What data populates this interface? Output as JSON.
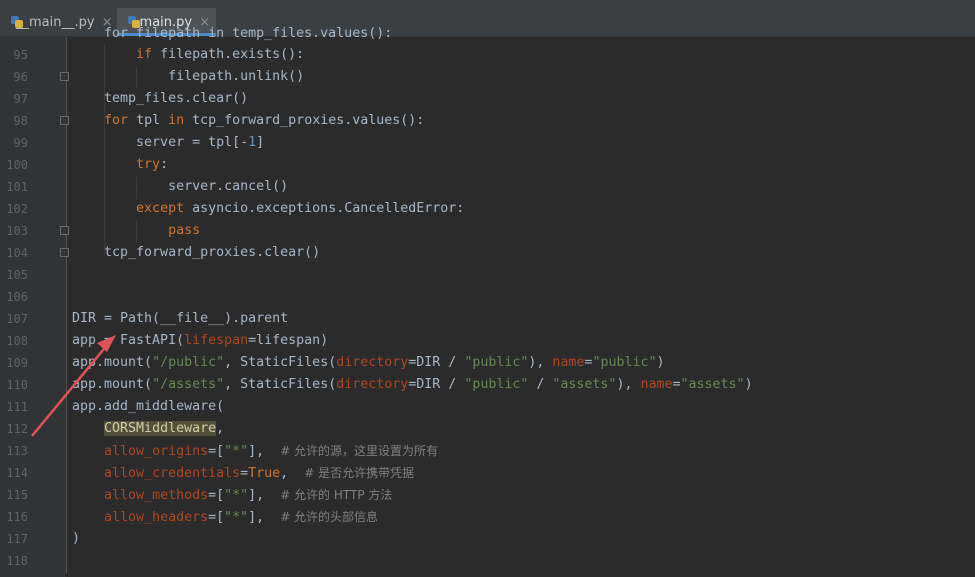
{
  "tabs": [
    {
      "label": "__main__.py",
      "close": "×",
      "active": false
    },
    {
      "label": "main.py",
      "close": "×",
      "active": true
    }
  ],
  "lines": [
    {
      "n": "95",
      "html": "        <span class=\"kw\">if</span> filepath.exists():"
    },
    {
      "n": "96",
      "html": "            filepath.unlink()"
    },
    {
      "n": "97",
      "html": "    temp_files.clear()"
    },
    {
      "n": "98",
      "html": "    <span class=\"kw\">for</span> tpl <span class=\"kw\">in</span> tcp_forward_proxies.values():"
    },
    {
      "n": "99",
      "html": "        server = tpl[-<span style=\"color:#6897bb\">1</span>]"
    },
    {
      "n": "100",
      "html": "        <span class=\"kw\">try</span>:"
    },
    {
      "n": "101",
      "html": "            server.cancel()"
    },
    {
      "n": "102",
      "html": "        <span class=\"kw\">except</span> asyncio.exceptions.CancelledError:"
    },
    {
      "n": "103",
      "html": "            <span class=\"kw\">pass</span>"
    },
    {
      "n": "104",
      "html": "    tcp_forward_proxies.clear()"
    },
    {
      "n": "105",
      "html": ""
    },
    {
      "n": "106",
      "html": ""
    },
    {
      "n": "107",
      "html": "DIR = Path(__file__).parent"
    },
    {
      "n": "108",
      "html": "app = FastAPI(<span class=\"par\">lifespan</span>=lifespan)"
    },
    {
      "n": "109",
      "html": "app.mount(<span class=\"str\">\"/public\"</span>, StaticFiles(<span class=\"par\">directory</span>=DIR / <span class=\"str\">\"public\"</span>), <span class=\"par\">name</span>=<span class=\"str\">\"public\"</span>)"
    },
    {
      "n": "110",
      "html": "app.mount(<span class=\"str\">\"/assets\"</span>, StaticFiles(<span class=\"par\">directory</span>=DIR / <span class=\"str\">\"public\"</span> / <span class=\"str\">\"assets\"</span>), <span class=\"par\">name</span>=<span class=\"str\">\"assets\"</span>)"
    },
    {
      "n": "111",
      "html": "app.add_middleware("
    },
    {
      "n": "112",
      "html": "    <span class=\"hl\">CORSMiddleware</span>,"
    },
    {
      "n": "113",
      "html": "    <span class=\"par\">allow_origins</span>=[<span class=\"str\">\"*\"</span>],  <span class=\"cm\"># 允许的源，这里设置为所有</span>"
    },
    {
      "n": "114",
      "html": "    <span class=\"par\">allow_credentials</span>=<span class=\"kw\">True</span>,  <span class=\"cm\"># 是否允许携带凭据</span>"
    },
    {
      "n": "115",
      "html": "    <span class=\"par\">allow_methods</span>=[<span class=\"str\">\"*\"</span>],  <span class=\"cm\"># 允许的 HTTP 方法</span>"
    },
    {
      "n": "116",
      "html": "    <span class=\"par\">allow_headers</span>=[<span class=\"str\">\"*\"</span>],  <span class=\"cm\"># 允许的头部信息</span>"
    },
    {
      "n": "117",
      "html": ")"
    },
    {
      "n": "118",
      "html": ""
    }
  ],
  "cut_line": "    for filepath in temp_files.values():",
  "fold_lines": [
    "96",
    "98",
    "103",
    "104"
  ],
  "arrow_color": "#e0525b"
}
